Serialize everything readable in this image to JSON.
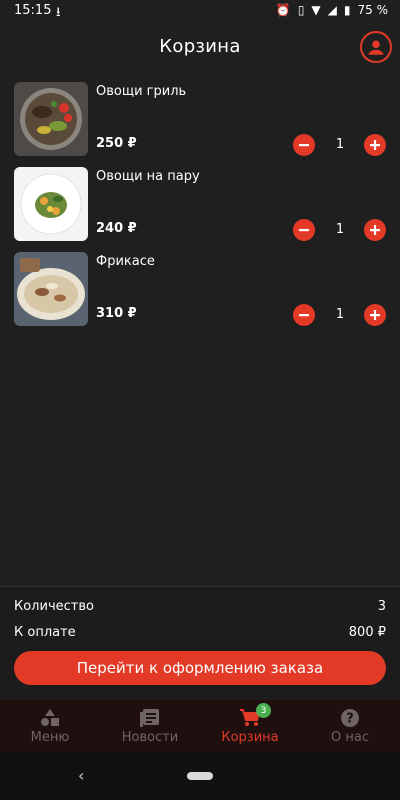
{
  "status": {
    "time": "15:15",
    "battery": "75 %"
  },
  "header": {
    "title": "Корзина"
  },
  "cart": {
    "items": [
      {
        "name": "Овощи гриль",
        "price": "250 ₽",
        "quantity": "1"
      },
      {
        "name": "Овощи на пару",
        "price": "240 ₽",
        "quantity": "1"
      },
      {
        "name": "Фрикасе",
        "price": "310 ₽",
        "quantity": "1"
      }
    ]
  },
  "summary": {
    "quantity_label": "Количество",
    "quantity_value": "3",
    "total_label": "К оплате",
    "total_value": "800 ₽",
    "checkout_label": "Перейти к оформлению заказа"
  },
  "nav": {
    "items": [
      {
        "label": "Меню",
        "icon": "shapes-icon"
      },
      {
        "label": "Новости",
        "icon": "news-icon"
      },
      {
        "label": "Корзина",
        "icon": "cart-icon",
        "badge": "3"
      },
      {
        "label": "О нас",
        "icon": "help-icon"
      }
    ]
  },
  "colors": {
    "accent": "#e33a27",
    "background": "#1f1f1f",
    "badge": "#4caf50",
    "nav_inactive": "#6f6565"
  }
}
